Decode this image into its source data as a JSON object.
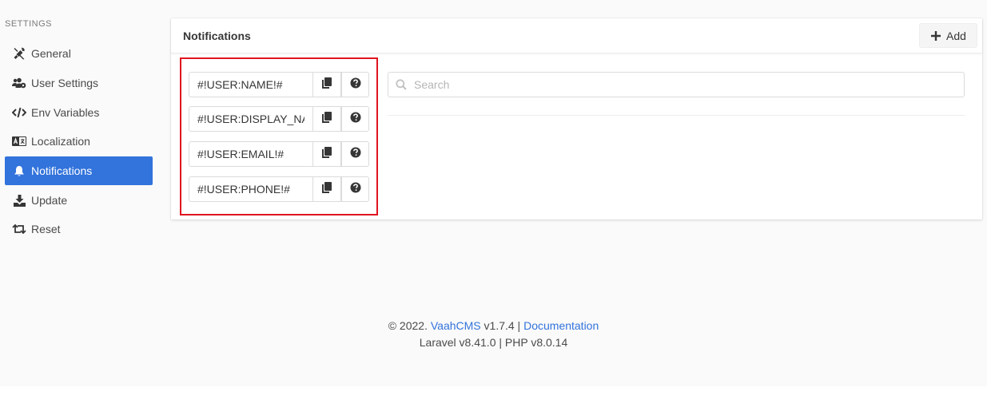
{
  "sidebar": {
    "label": "SETTINGS",
    "items": [
      {
        "label": "General",
        "icon": "tools-icon",
        "active": false
      },
      {
        "label": "User Settings",
        "icon": "users-cog-icon",
        "active": false
      },
      {
        "label": "Env Variables",
        "icon": "code-icon",
        "active": false
      },
      {
        "label": "Localization",
        "icon": "language-icon",
        "active": false
      },
      {
        "label": "Notifications",
        "icon": "bell-icon",
        "active": true
      },
      {
        "label": "Update",
        "icon": "download-icon",
        "active": false
      },
      {
        "label": "Reset",
        "icon": "retweet-icon",
        "active": false
      }
    ]
  },
  "card": {
    "title": "Notifications",
    "add_label": "Add"
  },
  "variables": [
    {
      "value": "#!USER:NAME!#"
    },
    {
      "value": "#!USER:DISPLAY_NAME!#"
    },
    {
      "value": "#!USER:EMAIL!#"
    },
    {
      "value": "#!USER:PHONE!#"
    }
  ],
  "search": {
    "placeholder": "Search",
    "value": ""
  },
  "footer": {
    "copyright": "© 2022.",
    "brand": "VaahCMS",
    "version": "v1.7.4 |",
    "docs": "Documentation",
    "line2": "Laravel v8.41.0 | PHP v8.0.14"
  },
  "colors": {
    "accent": "#3273dc",
    "highlight": "#e0141e"
  }
}
